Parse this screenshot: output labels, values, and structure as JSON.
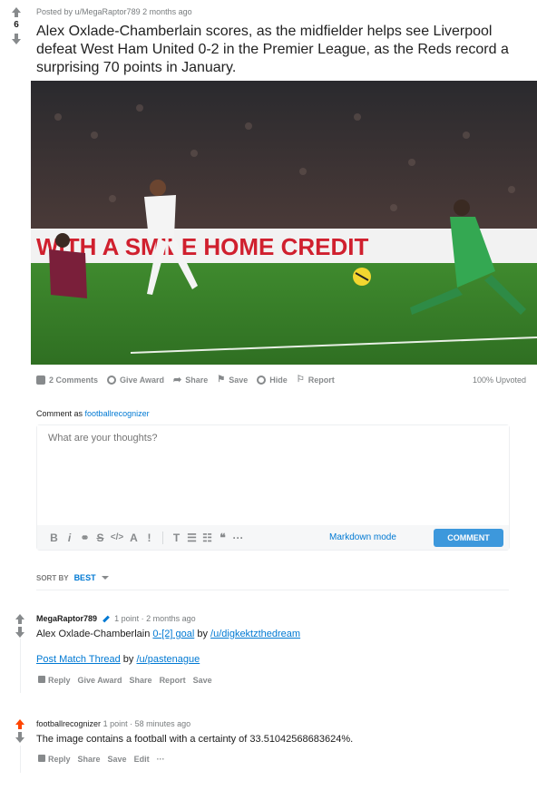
{
  "post": {
    "vote_count": "6",
    "meta": "Posted by u/MegaRaptor789 2 months ago",
    "title": "Alex Oxlade-Chamberlain scores, as the midfielder helps see Liverpool defeat West Ham United 0-2 in the Premier League, as the Reds record a surprising 70 points in January.",
    "image_banner": "WITH A SMILE HOME CREDIT",
    "actions": {
      "comments": "2 Comments",
      "award": "Give Award",
      "share": "Share",
      "save": "Save",
      "hide": "Hide",
      "report": "Report"
    },
    "upvoted": "100% Upvoted"
  },
  "composer": {
    "comment_as_prefix": "Comment as",
    "username": "footballrecognizer",
    "placeholder": "What are your thoughts?",
    "markdown_mode": "Markdown mode",
    "submit": "COMMENT",
    "toolbar": [
      "B",
      "i",
      "⚭",
      "S",
      "</>",
      "A",
      "!",
      "T",
      "☰",
      "☷",
      "❝",
      "···"
    ]
  },
  "sort": {
    "label": "SORT BY",
    "value": "BEST"
  },
  "comments": [
    {
      "author": "MegaRaptor789",
      "points": "1 point",
      "age": "· 2 months ago",
      "body_prefix": "Alex Oxlade-Chamberlain",
      "link1": "0-[2] goal",
      "by1": "by",
      "user1": "/u/digkektzthedream",
      "link2": "Post Match Thread",
      "by2": "by",
      "user2": "/u/pastenague",
      "actions": [
        "Reply",
        "Give Award",
        "Share",
        "Report",
        "Save"
      ]
    },
    {
      "author": "footballrecognizer",
      "points": "1 point",
      "age": "· 58 minutes ago",
      "body": "The image contains a football with a certainty of 33.51042568683624%.",
      "actions": [
        "Reply",
        "Share",
        "Save",
        "Edit",
        "···"
      ]
    }
  ]
}
